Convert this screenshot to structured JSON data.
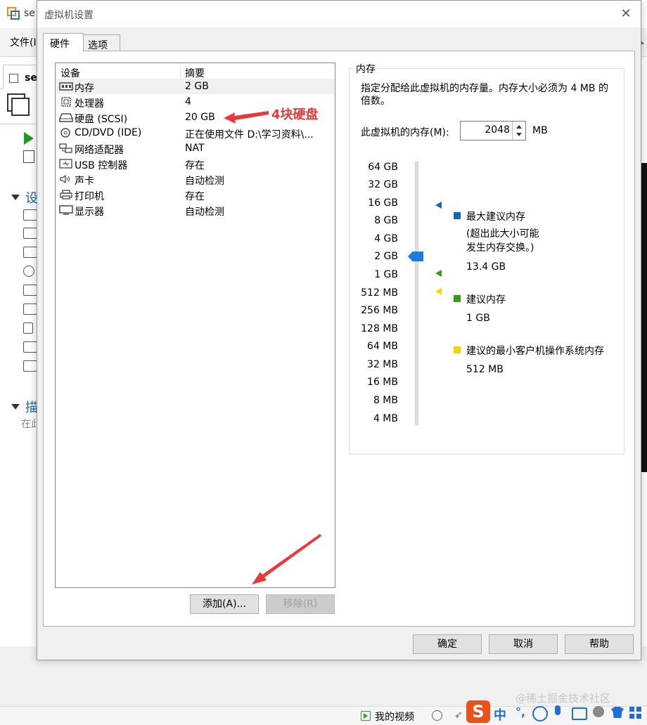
{
  "background": {
    "app_title_fragment": "se",
    "menu_file": "文件(I",
    "tab_label_fragment": "se",
    "section_devices": "设",
    "section_description": "描",
    "description_fragment": "在此"
  },
  "dialog": {
    "title": "虚拟机设置",
    "tabs": [
      {
        "label": "硬件"
      },
      {
        "label": "选项"
      }
    ],
    "device_list": {
      "headers": {
        "device": "设备",
        "summary": "摘要"
      },
      "rows": [
        {
          "device": "内存",
          "summary": "2 GB",
          "icon": "memory-icon"
        },
        {
          "device": "处理器",
          "summary": "4",
          "icon": "cpu-icon"
        },
        {
          "device": "硬盘 (SCSI)",
          "summary": "20 GB",
          "icon": "harddisk-icon"
        },
        {
          "device": "CD/DVD (IDE)",
          "summary": "正在使用文件 D:\\学习资料\\...",
          "icon": "cd-dvd-icon"
        },
        {
          "device": "网络适配器",
          "summary": "NAT",
          "icon": "network-adapter-icon"
        },
        {
          "device": "USB 控制器",
          "summary": "存在",
          "icon": "usb-icon"
        },
        {
          "device": "声卡",
          "summary": "自动检测",
          "icon": "speaker-icon"
        },
        {
          "device": "打印机",
          "summary": "存在",
          "icon": "printer-icon"
        },
        {
          "device": "显示器",
          "summary": "自动检测",
          "icon": "monitor-icon"
        }
      ],
      "selected_index": 0
    },
    "buttons": {
      "add": "添加(A)...",
      "remove": "移除(R)",
      "ok": "确定",
      "cancel": "取消",
      "help": "帮助"
    },
    "memory": {
      "group_title": "内存",
      "description": "指定分配给此虚拟机的内存量。内存大小必须为 4 MB 的倍数。",
      "input_label": "此虚拟机的内存(M):",
      "input_value": "2048",
      "unit": "MB",
      "scale_ticks": [
        "64 GB",
        "32 GB",
        "16 GB",
        "8 GB",
        "4 GB",
        "2 GB",
        "1 GB",
        "512 MB",
        "256 MB",
        "128 MB",
        "64 MB",
        "32 MB",
        "16 MB",
        "8 MB",
        "4 MB"
      ],
      "current_tick": "2 GB",
      "legend": {
        "max": {
          "title": "最大建议内存",
          "note_line1": "(超出此大小可能",
          "note_line2": "发生内存交换。)",
          "value": "13.4 GB",
          "color": "#1565c0"
        },
        "recommended": {
          "title": "建议内存",
          "value": "1 GB",
          "color": "#3a9a1a"
        },
        "min_guest": {
          "title": "建议的最小客户机操作系统内存",
          "value": "512 MB",
          "color": "#f2d600"
        }
      }
    }
  },
  "annotation": {
    "label": "4块硬盘",
    "color": "#e8393a"
  },
  "taskbar": {
    "video_label": "我的视频",
    "ime_zh": "中",
    "ime_punc": "°,",
    "ime_brand": "S"
  },
  "watermark": "@稀土掘金技术社区"
}
